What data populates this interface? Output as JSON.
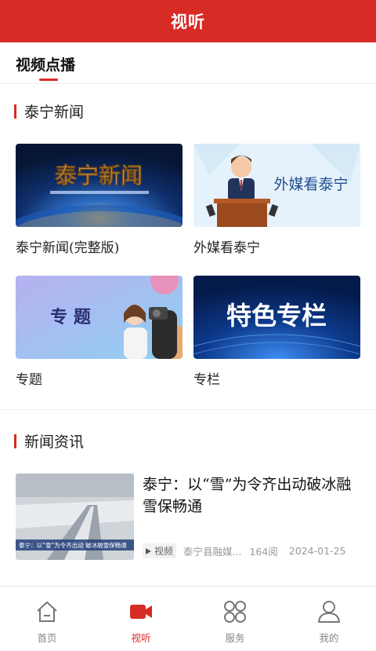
{
  "header": {
    "title": "视听"
  },
  "page_tab": {
    "label": "视频点播"
  },
  "sections": {
    "taining_news": {
      "title": "泰宁新闻",
      "cards": [
        {
          "caption": "泰宁新闻(完整版)",
          "thumb_text": "泰宁新闻"
        },
        {
          "caption": "外媒看泰宁",
          "thumb_text": "外媒看泰宁"
        },
        {
          "caption": "专题",
          "thumb_text": "专 题"
        },
        {
          "caption": "专栏",
          "thumb_text": "特色专栏"
        }
      ]
    },
    "news_info": {
      "title": "新闻资讯",
      "items": [
        {
          "headline": "泰宁：以“雪”为令齐出动破冰融雪保畅通",
          "tag": "视频",
          "source": "泰宁县融媒...",
          "reads": "164阅",
          "date": "2024-01-25",
          "thumb_caption": "泰宁：以“雪”为令齐出动 破冰融雪保畅通"
        }
      ]
    }
  },
  "tabbar": {
    "items": [
      {
        "label": "首页",
        "icon": "home-icon",
        "active": false
      },
      {
        "label": "视听",
        "icon": "video-camera-icon",
        "active": true
      },
      {
        "label": "服务",
        "icon": "grid-circles-icon",
        "active": false
      },
      {
        "label": "我的",
        "icon": "user-icon",
        "active": false
      }
    ]
  },
  "colors": {
    "brand": "#d72b25",
    "text": "#222222",
    "muted": "#999999"
  }
}
